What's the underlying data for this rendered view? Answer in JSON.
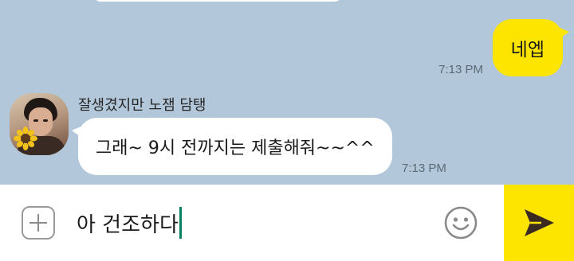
{
  "messages": {
    "outgoing": {
      "text": "네엡",
      "time": "7:13 PM"
    },
    "incoming": {
      "sender": "잘생겼지만 노잼 담탱",
      "text": "그래~ 9시 전까지는 제출해줘~~^^",
      "time": "7:13 PM"
    }
  },
  "composer": {
    "draft": "아 건조하다"
  },
  "icons": {
    "add": "plus-square-icon",
    "emoji": "smiley-icon",
    "send": "paper-plane-icon"
  },
  "colors": {
    "chat_bg": "#b2c7d9",
    "accent": "#fee500",
    "caret": "#0a7f62"
  }
}
